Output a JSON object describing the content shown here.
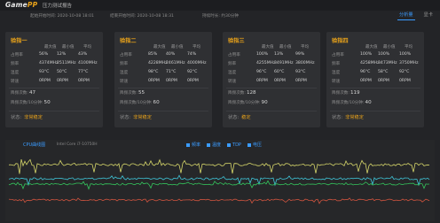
{
  "app": {
    "logo_main": "Game",
    "logo_accent": "PP",
    "title": "压力测试报告"
  },
  "info": {
    "start": "起始开始时间: 2020-10-08 18:01",
    "end": "结束开始时间: 2020-10-08 18:31",
    "duration": "持续时长: 约30分钟"
  },
  "tabs": [
    "分析量",
    "显卡"
  ],
  "cards": [
    {
      "title": "验指一",
      "cols": [
        "最大值",
        "最小值",
        "平均"
      ],
      "rows": [
        {
          "label": "占用率",
          "vals": [
            "56%",
            "12%",
            "43%"
          ]
        },
        {
          "label": "频率",
          "vals": [
            "4374MHz",
            "2511MHz",
            "4100MHz"
          ]
        },
        {
          "label": "温度",
          "vals": [
            "93°C",
            "50°C",
            "77°C"
          ]
        },
        {
          "label": "转速",
          "vals": [
            "0RPM",
            "0RPM",
            "0RPM"
          ]
        }
      ],
      "count_label": "降频次数:",
      "count": "47",
      "rate_label": "降频次数/10分钟:",
      "rate": "50",
      "status_label": "状态:",
      "status": "非常稳定"
    },
    {
      "title": "验指二",
      "cols": [
        "最大值",
        "最小值",
        "平均"
      ],
      "rows": [
        {
          "label": "占用率",
          "vals": [
            "85%",
            "40%",
            "74%"
          ]
        },
        {
          "label": "频率",
          "vals": [
            "4228MHz",
            "2461MHz",
            "4000MHz"
          ]
        },
        {
          "label": "温度",
          "vals": [
            "98°C",
            "71°C",
            "92°C"
          ]
        },
        {
          "label": "转速",
          "vals": [
            "0RPM",
            "0RPM",
            "0RPM"
          ]
        }
      ],
      "count_label": "降频次数:",
      "count": "55",
      "rate_label": "降频次数/10分钟:",
      "rate": "60",
      "status_label": "状态:",
      "status": "非常稳定"
    },
    {
      "title": "验指三",
      "cols": [
        "最大值",
        "最小值",
        "平均"
      ],
      "rows": [
        {
          "label": "占用率",
          "vals": [
            "100%",
            "13%",
            "99%"
          ]
        },
        {
          "label": "频率",
          "vals": [
            "4255MHz",
            "3491MHz",
            "3800MHz"
          ]
        },
        {
          "label": "温度",
          "vals": [
            "96°C",
            "60°C",
            "93°C"
          ]
        },
        {
          "label": "转速",
          "vals": [
            "0RPM",
            "0RPM",
            "0RPM"
          ]
        }
      ],
      "count_label": "降频次数:",
      "count": "128",
      "rate_label": "降频次数/10分钟:",
      "rate": "90",
      "status_label": "状态:",
      "status": "稳定"
    },
    {
      "title": "验指四",
      "cols": [
        "最大值",
        "最小值",
        "平均"
      ],
      "rows": [
        {
          "label": "占用率",
          "vals": [
            "100%",
            "100%",
            "100%"
          ]
        },
        {
          "label": "频率",
          "vals": [
            "4258MHz",
            "3473MHz",
            "3750MHz"
          ]
        },
        {
          "label": "温度",
          "vals": [
            "96°C",
            "58°C",
            "92°C"
          ]
        },
        {
          "label": "转速",
          "vals": [
            "0RPM",
            "0RPM",
            "0RPM"
          ]
        }
      ],
      "count_label": "降频次数:",
      "count": "119",
      "rate_label": "降频次数/10分钟:",
      "rate": "40",
      "status_label": "状态:",
      "status": "非常稳定"
    }
  ],
  "chart": {
    "title": "CPU曲线图",
    "subtitle": "Intel Core i7-10750H",
    "legend": [
      "频率",
      "温度",
      "TDP",
      "电压"
    ],
    "colors": {
      "yellow": "#d6d66a",
      "green": "#34c45c",
      "cyan": "#3fc5d8",
      "red": "#d0543f"
    }
  },
  "colors": {
    "accent": "#e8a21a",
    "blue": "#3b9cff"
  }
}
